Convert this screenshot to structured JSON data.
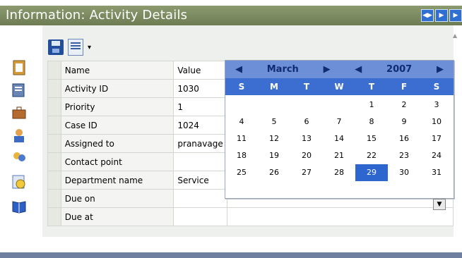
{
  "window": {
    "title": "Information: Activity Details",
    "buttons": [
      "◀▶",
      "▶",
      "▶"
    ]
  },
  "toolbar": {
    "save_icon": "save-icon",
    "edit_icon": "edit-icon"
  },
  "grid": {
    "headers": {
      "name": "Name",
      "value": "Value"
    },
    "rows": [
      {
        "name": "Activity ID",
        "value": "1030"
      },
      {
        "name": "Priority",
        "value": "1"
      },
      {
        "name": "Case ID",
        "value": "1024"
      },
      {
        "name": "Assigned to",
        "value": "pranavage"
      },
      {
        "name": "Contact point",
        "value": ""
      },
      {
        "name": "Department name",
        "value": "Service"
      },
      {
        "name": "Due on",
        "value": ""
      },
      {
        "name": "Due at",
        "value": ""
      }
    ]
  },
  "calendar": {
    "month": "March",
    "year": "2007",
    "prev_month": "◀",
    "next_month": "▶",
    "prev_year": "◀",
    "next_year": "▶",
    "days": [
      "S",
      "M",
      "T",
      "W",
      "T",
      "F",
      "S"
    ],
    "cells": [
      "",
      "",
      "",
      "",
      "1",
      "2",
      "3",
      "4",
      "5",
      "6",
      "7",
      "8",
      "9",
      "10",
      "11",
      "12",
      "13",
      "14",
      "15",
      "16",
      "17",
      "18",
      "19",
      "20",
      "21",
      "22",
      "23",
      "24",
      "25",
      "26",
      "27",
      "28",
      "29",
      "30",
      "31"
    ],
    "selected": "29"
  }
}
